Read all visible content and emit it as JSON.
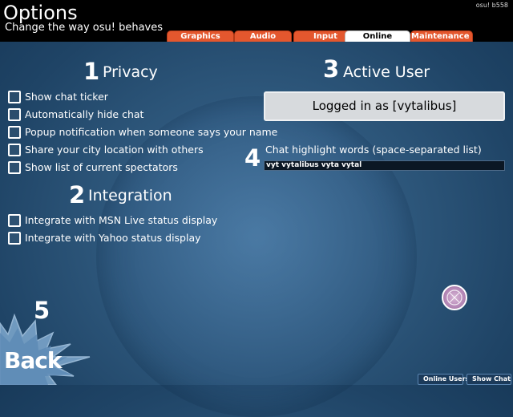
{
  "header": {
    "title": "Options",
    "subtitle": "Change the way osu! behaves",
    "version": "osu! b558"
  },
  "tabs": [
    {
      "label": "Graphics",
      "active": false
    },
    {
      "label": "Audio",
      "active": false
    },
    {
      "label": "Input",
      "active": false
    },
    {
      "label": "Online",
      "active": true
    },
    {
      "label": "Maintenance",
      "active": false
    }
  ],
  "privacy": {
    "number": "1",
    "heading": "Privacy",
    "options": [
      {
        "label": "Show chat ticker",
        "checked": false
      },
      {
        "label": "Automatically hide chat",
        "checked": false
      },
      {
        "label": "Popup notification when someone says your name",
        "checked": false
      },
      {
        "label": "Share your city location with others",
        "checked": false
      },
      {
        "label": "Show list of current spectators",
        "checked": false
      }
    ]
  },
  "integration": {
    "number": "2",
    "heading": "Integration",
    "options": [
      {
        "label": "Integrate with MSN Live status display",
        "checked": false
      },
      {
        "label": "Integrate with Yahoo status display",
        "checked": false
      }
    ]
  },
  "active_user": {
    "number": "3",
    "heading": "Active User",
    "logged_in_label": "Logged in as [vytalibus]"
  },
  "highlight": {
    "number": "4",
    "label": "Chat highlight words (space-separated list)",
    "value": "vyt vytalibus vyta vytal"
  },
  "back": {
    "number": "5",
    "label": "Back"
  },
  "bottom_buttons": {
    "online_users": "Online Users",
    "show_chat": "Show Chat"
  },
  "colors": {
    "tab_inactive": "#e4572e",
    "tab_active": "#ffffff",
    "background": "#2c5579",
    "logged_button": "#d7dadd"
  }
}
